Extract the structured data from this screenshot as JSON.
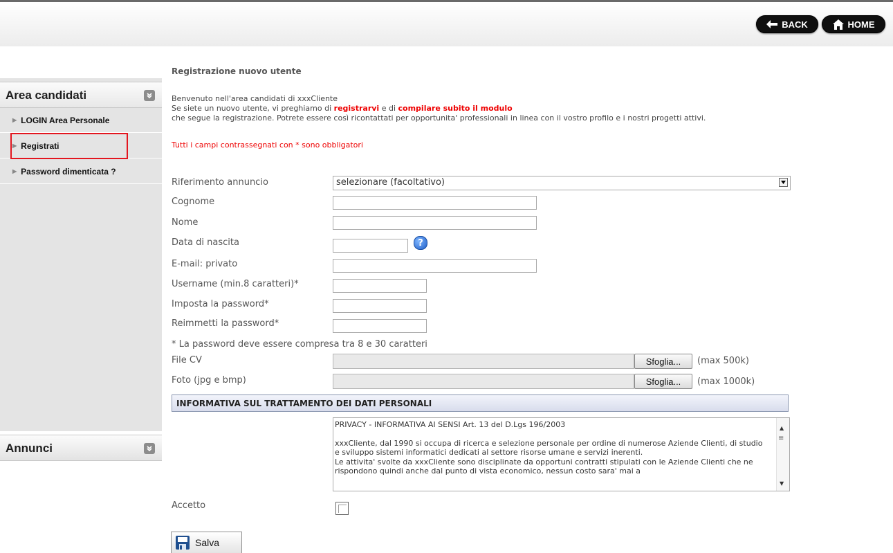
{
  "header": {
    "back_label": "BACK",
    "home_label": "HOME"
  },
  "sidebar": {
    "area_candidati_title": "Area candidati",
    "items": [
      {
        "label": "LOGIN Area Personale"
      },
      {
        "label": "Registrati"
      },
      {
        "label": "Password dimenticata ?"
      }
    ],
    "annunci_title": "Annunci"
  },
  "main": {
    "title": "Registrazione nuovo utente",
    "intro_line1": "Benvenuto nell'area candidati di xxxCliente",
    "intro_line2_a": "Se siete un nuovo utente, vi preghiamo di ",
    "intro_line2_b": "registrarvi",
    "intro_line2_c": " e di ",
    "intro_line2_d": "compilare subito il modulo",
    "intro_line3": "che segue la registrazione. Potrete essere così ricontattati per opportunita' professionali in linea con il vostro profilo e i nostri progetti attivi.",
    "required_note": "Tutti i campi contrassegnati con * sono obbligatori"
  },
  "form": {
    "riferimento_label": "Riferimento annuncio",
    "riferimento_value": "selezionare (facoltativo)",
    "cognome_label": "Cognome",
    "nome_label": "Nome",
    "data_nascita_label": "Data di nascita",
    "email_label": "E-mail: privato",
    "username_label": "Username (min.8 caratteri)*",
    "password_label": "Imposta la password*",
    "password2_label": "Reimmetti la password*",
    "password_note": "* La password deve essere compresa tra 8 e 30 caratteri",
    "file_cv_label": "File CV",
    "file_cv_max": "(max 500k)",
    "foto_label": "Foto (jpg e bmp)",
    "foto_max": "(max 1000k)",
    "browse_label": "Sfoglia...",
    "help_symbol": "?",
    "privacy_section": "INFORMATIVA SUL TRATTAMENTO DEI DATI PERSONALI",
    "privacy_p1": "PRIVACY - INFORMATIVA AI SENSI Art. 13 del D.Lgs 196/2003",
    "privacy_p2": "xxxCliente, dal 1990 si occupa di ricerca e selezione personale per ordine di numerose Aziende Clienti, di studio e sviluppo sistemi informatici dedicati al settore risorse umane e servizi inerenti.",
    "privacy_p3": "Le attivita' svolte da xxxCliente sono disciplinate da opportuni contratti stipulati con le Aziende Clienti che ne rispondono quindi anche dal punto di vista economico, nessun costo sara' mai a",
    "accetto_label": "Accetto",
    "save_label": "Salva"
  }
}
